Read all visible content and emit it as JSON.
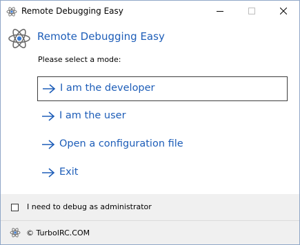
{
  "window": {
    "title": "Remote Debugging Easy",
    "icon": "atom-icon"
  },
  "header": {
    "title": "Remote Debugging Easy",
    "prompt": "Please select a mode:"
  },
  "modes": [
    {
      "label": "I am the developer",
      "focused": true
    },
    {
      "label": "I am the user",
      "focused": false
    },
    {
      "label": "Open a configuration file",
      "focused": false
    },
    {
      "label": "Exit",
      "focused": false
    }
  ],
  "footer": {
    "admin_checkbox_label": "I need to debug as administrator",
    "admin_checked": false,
    "copyright": "© TurboIRC.COM"
  },
  "colors": {
    "accent": "#1d5db8",
    "footer_bg": "#f0f0f0"
  }
}
